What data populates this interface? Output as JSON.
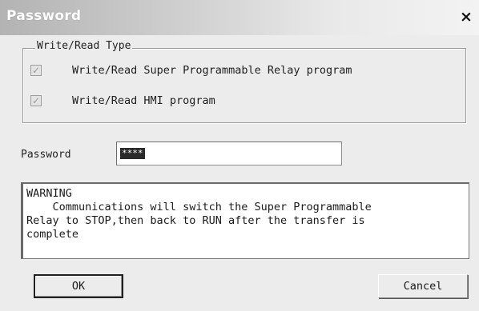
{
  "dialog": {
    "title": "Password",
    "close_label": "×"
  },
  "rw_type": {
    "legend": "Write/Read Type",
    "options": [
      {
        "label": "Write/Read Super Programmable Relay program",
        "checked": true,
        "enabled": false,
        "mark": "✓"
      },
      {
        "label": "Write/Read HMI program",
        "checked": true,
        "enabled": false,
        "mark": "✓"
      }
    ]
  },
  "password": {
    "label": "Password",
    "value": "****"
  },
  "message": {
    "text": "WARNING\n    Communications will switch the Super Programmable\nRelay to STOP,then back to RUN after the transfer is\ncomplete"
  },
  "buttons": {
    "ok": "OK",
    "cancel": "Cancel"
  }
}
